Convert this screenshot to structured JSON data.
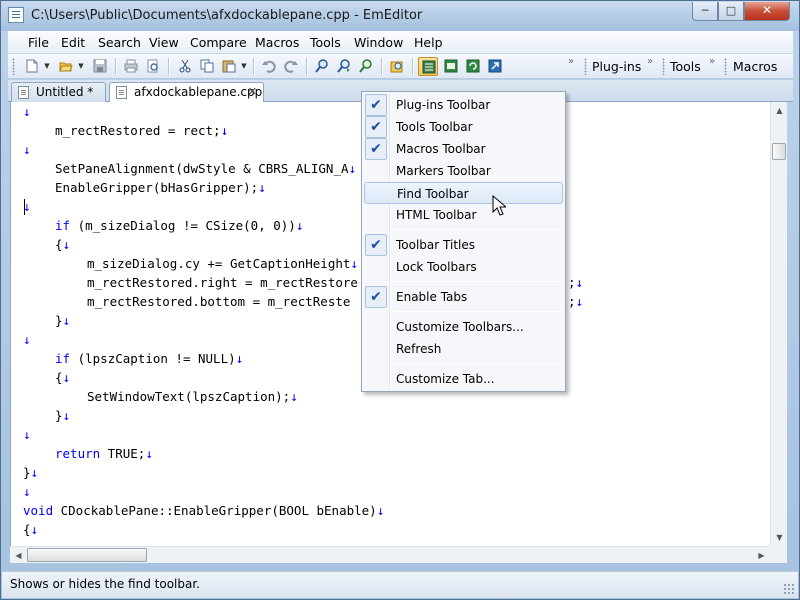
{
  "window": {
    "title": "C:\\Users\\Public\\Documents\\afxdockablepane.cpp - EmEditor",
    "controls": {
      "minimize": "─",
      "maximize": "□",
      "close": "✕"
    }
  },
  "menubar": {
    "items": [
      "File",
      "Edit",
      "Search",
      "View",
      "Compare",
      "Macros",
      "Tools",
      "Window",
      "Help"
    ]
  },
  "toolbar": {
    "buttons": [
      "new-document-icon",
      "open-folder-icon",
      "save-icon",
      "print-icon",
      "print-preview-icon",
      "cut-icon",
      "copy-icon",
      "paste-icon",
      "undo-icon",
      "redo-icon",
      "find-icon",
      "find-next-icon",
      "find-previous-icon",
      "find-in-files-icon",
      "toolbar-markers-icon",
      "toolbar-green-icon",
      "refresh-icon",
      "export-icon"
    ],
    "labels": {
      "plugins": "Plug-ins",
      "tools": "Tools",
      "macros": "Macros"
    },
    "chevron": "»"
  },
  "tabs": [
    {
      "label": "Untitled *",
      "active": false
    },
    {
      "label": "afxdockablepane.cpp",
      "active": true,
      "close": "✕"
    }
  ],
  "editor": {
    "newline_mark": "↓",
    "lines": [
      {
        "indent": 0,
        "text": ""
      },
      {
        "indent": 1,
        "text": "m_rectRestored = rect;"
      },
      {
        "indent": 0,
        "text": ""
      },
      {
        "indent": 1,
        "text": "SetPaneAlignment(dwStyle & CBRS_ALIGN_A"
      },
      {
        "indent": 1,
        "text": "EnableGripper(bHasGripper);"
      },
      {
        "indent": 0,
        "text": ""
      },
      {
        "indent": 1,
        "text": "if (m_sizeDialog != CSize(0, 0))"
      },
      {
        "indent": 1,
        "text": "{"
      },
      {
        "indent": 2,
        "text": "m_sizeDialog.cy += GetCaptionHeight"
      },
      {
        "indent": 2,
        "text": "m_rectRestored.right = m_rectRestore",
        "tail": ";"
      },
      {
        "indent": 2,
        "text": "m_rectRestored.bottom = m_rectReste",
        "tail": ";"
      },
      {
        "indent": 1,
        "text": "}"
      },
      {
        "indent": 0,
        "text": ""
      },
      {
        "indent": 1,
        "text": "if (lpszCaption != NULL)"
      },
      {
        "indent": 1,
        "text": "{"
      },
      {
        "indent": 2,
        "text": "SetWindowText(lpszCaption);"
      },
      {
        "indent": 1,
        "text": "}"
      },
      {
        "indent": 0,
        "text": ""
      },
      {
        "indent": 1,
        "text": "return TRUE;"
      },
      {
        "indent": 0,
        "text": "}"
      },
      {
        "indent": 0,
        "text": ""
      },
      {
        "indent": 0,
        "text": "void CDockablePane::EnableGripper(BOOL bEnable)"
      },
      {
        "indent": 0,
        "text": "{"
      }
    ],
    "keywords": [
      "if",
      "return",
      "void"
    ]
  },
  "context_menu": {
    "items": [
      {
        "label": "Plug-ins Toolbar",
        "checked": true
      },
      {
        "label": "Tools Toolbar",
        "checked": true
      },
      {
        "label": "Macros Toolbar",
        "checked": true
      },
      {
        "label": "Markers Toolbar",
        "checked": false
      },
      {
        "label": "Find Toolbar",
        "checked": false,
        "hover": true
      },
      {
        "label": "HTML Toolbar",
        "checked": false
      },
      {
        "separator": true
      },
      {
        "label": "Toolbar Titles",
        "checked": true
      },
      {
        "label": "Lock Toolbars",
        "checked": false
      },
      {
        "separator": true
      },
      {
        "label": "Enable Tabs",
        "checked": true
      },
      {
        "separator": true
      },
      {
        "label": "Customize Toolbars...",
        "checked": false
      },
      {
        "label": "Refresh",
        "checked": false
      },
      {
        "separator": true
      },
      {
        "label": "Customize Tab...",
        "checked": false
      }
    ],
    "check_glyph": "✔"
  },
  "statusbar": {
    "text": "Shows or hides the find toolbar."
  },
  "colors": {
    "keyword": "#0000ff",
    "newline_mark": "#0000ff",
    "accent": "#1c4f9c",
    "close_button": "#c7503a"
  }
}
